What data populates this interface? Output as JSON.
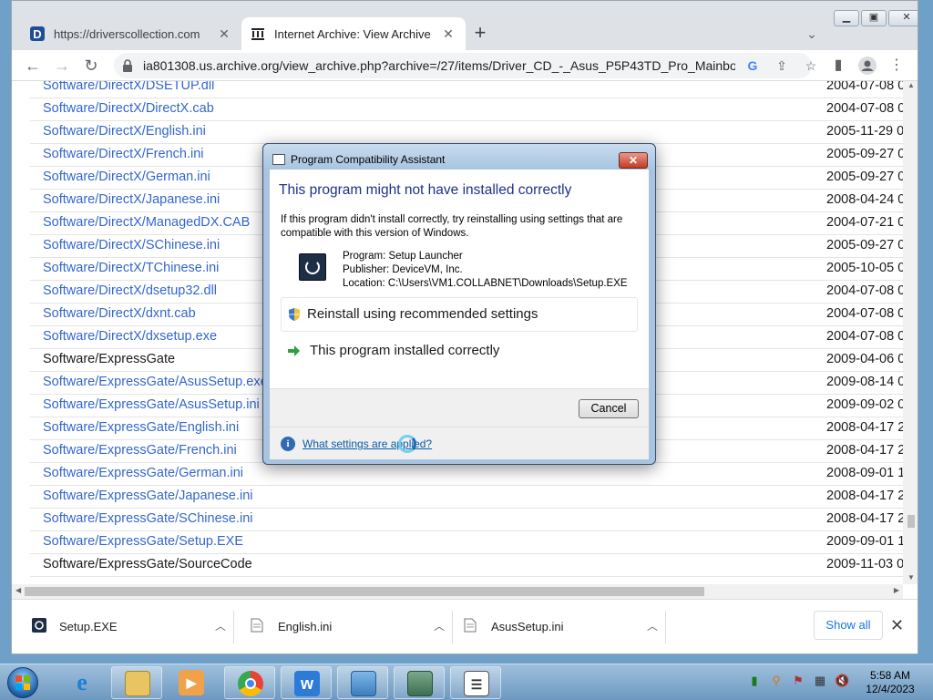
{
  "browser": {
    "tabs": [
      {
        "title": "https://driverscollection.com",
        "favicon": "D",
        "active": false
      },
      {
        "title": "Internet Archive: View Archive",
        "favicon": "archive-icon",
        "active": true
      }
    ],
    "url": "ia801308.us.archive.org/view_archive.php?archive=/27/items/Driver_CD_-_Asus_P5P43TD_Pro_Mainbo..."
  },
  "files": [
    {
      "name": "Software/DirectX/DSETUP.dll",
      "date": "2004-07-08 0",
      "link": true
    },
    {
      "name": "Software/DirectX/DirectX.cab",
      "date": "2004-07-08 0",
      "link": true
    },
    {
      "name": "Software/DirectX/English.ini",
      "date": "2005-11-29 0",
      "link": true
    },
    {
      "name": "Software/DirectX/French.ini",
      "date": "2005-09-27 0",
      "link": true
    },
    {
      "name": "Software/DirectX/German.ini",
      "date": "2005-09-27 0",
      "link": true
    },
    {
      "name": "Software/DirectX/Japanese.ini",
      "date": "2008-04-24 0",
      "link": true
    },
    {
      "name": "Software/DirectX/ManagedDX.CAB",
      "date": "2004-07-21 0",
      "link": true
    },
    {
      "name": "Software/DirectX/SChinese.ini",
      "date": "2005-09-27 0",
      "link": true
    },
    {
      "name": "Software/DirectX/TChinese.ini",
      "date": "2005-10-05 0",
      "link": true
    },
    {
      "name": "Software/DirectX/dsetup32.dll",
      "date": "2004-07-08 0",
      "link": true
    },
    {
      "name": "Software/DirectX/dxnt.cab",
      "date": "2004-07-08 0",
      "link": true
    },
    {
      "name": "Software/DirectX/dxsetup.exe",
      "date": "2004-07-08 0",
      "link": true
    },
    {
      "name": "Software/ExpressGate",
      "date": "2009-04-06 0",
      "link": false
    },
    {
      "name": "Software/ExpressGate/AsusSetup.exe",
      "date": "2009-08-14 0",
      "link": true
    },
    {
      "name": "Software/ExpressGate/AsusSetup.ini",
      "date": "2009-09-02 0",
      "link": true
    },
    {
      "name": "Software/ExpressGate/English.ini",
      "date": "2008-04-17 2",
      "link": true
    },
    {
      "name": "Software/ExpressGate/French.ini",
      "date": "2008-04-17 2",
      "link": true
    },
    {
      "name": "Software/ExpressGate/German.ini",
      "date": "2008-09-01 1",
      "link": true
    },
    {
      "name": "Software/ExpressGate/Japanese.ini",
      "date": "2008-04-17 2",
      "link": true
    },
    {
      "name": "Software/ExpressGate/SChinese.ini",
      "date": "2008-04-17 2",
      "link": true
    },
    {
      "name": "Software/ExpressGate/Setup.EXE",
      "date": "2009-09-01 1",
      "link": true
    },
    {
      "name": "Software/ExpressGate/SourceCode",
      "date": "2009-11-03 0",
      "link": false
    }
  ],
  "downloads": {
    "items": [
      {
        "name": "Setup.EXE"
      },
      {
        "name": "English.ini"
      },
      {
        "name": "AsusSetup.ini"
      }
    ],
    "show_all": "Show all"
  },
  "dialog": {
    "title": "Program Compatibility Assistant",
    "heading": "This program might not have installed correctly",
    "message": "If this program didn't install correctly, try reinstalling using settings that are compatible with this version of Windows.",
    "program": "Program: Setup Launcher",
    "publisher": "Publisher: DeviceVM, Inc.",
    "location": "Location: C:\\Users\\VM1.COLLABNET\\Downloads\\Setup.EXE",
    "option_reinstall": "Reinstall using recommended settings",
    "option_correct": "This program installed correctly",
    "cancel": "Cancel",
    "help_link": "What settings are applied?"
  },
  "taskbar": {
    "time": "5:58 AM",
    "date": "12/4/2023"
  }
}
